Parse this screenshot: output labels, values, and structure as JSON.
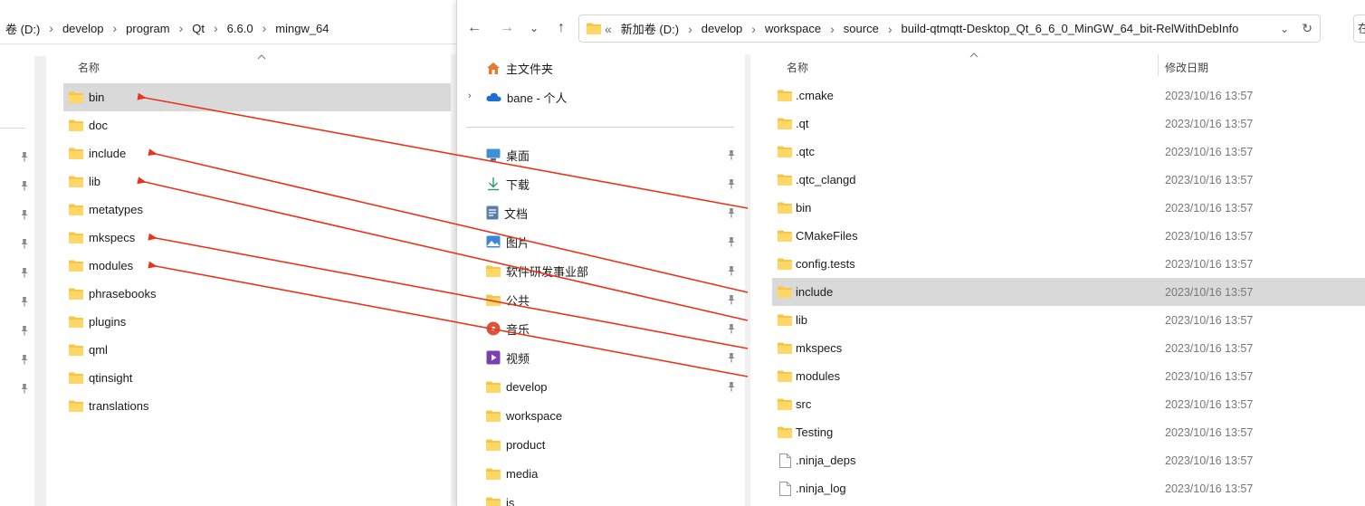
{
  "left": {
    "breadcrumb": [
      "卷 (D:)",
      "develop",
      "program",
      "Qt",
      "6.6.0",
      "mingw_64"
    ],
    "column_name": "名称",
    "items": [
      {
        "name": "bin",
        "selected": true
      },
      {
        "name": "doc"
      },
      {
        "name": "include"
      },
      {
        "name": "lib"
      },
      {
        "name": "metatypes"
      },
      {
        "name": "mkspecs"
      },
      {
        "name": "modules"
      },
      {
        "name": "phrasebooks"
      },
      {
        "name": "plugins"
      },
      {
        "name": "qml"
      },
      {
        "name": "qtinsight"
      },
      {
        "name": "translations"
      }
    ]
  },
  "right": {
    "breadcrumb_prefix": "«",
    "breadcrumb": [
      "新加卷 (D:)",
      "develop",
      "workspace",
      "source",
      "build-qtmqtt-Desktop_Qt_6_6_0_MinGW_64_bit-RelWithDebInfo"
    ],
    "search_placeholder": "在",
    "nav": {
      "home": "主文件夹",
      "onedrive": "bane - 个人",
      "quick": [
        {
          "label": "桌面",
          "icon": "desktop-icon",
          "pinned": true
        },
        {
          "label": "下载",
          "icon": "download-icon",
          "pinned": true
        },
        {
          "label": "文档",
          "icon": "document-icon",
          "pinned": true
        },
        {
          "label": "图片",
          "icon": "picture-icon",
          "pinned": true
        },
        {
          "label": "软件研发事业部",
          "icon": "folder-icon",
          "pinned": true
        },
        {
          "label": "公共",
          "icon": "folder-icon",
          "pinned": true
        },
        {
          "label": "音乐",
          "icon": "music-icon",
          "pinned": true
        },
        {
          "label": "视频",
          "icon": "video-icon",
          "pinned": true
        },
        {
          "label": "develop",
          "icon": "folder-icon",
          "pinned": true
        },
        {
          "label": "workspace",
          "icon": "folder-icon",
          "pinned": false
        },
        {
          "label": "product",
          "icon": "folder-icon",
          "pinned": false
        },
        {
          "label": "media",
          "icon": "folder-icon",
          "pinned": false
        },
        {
          "label": "js",
          "icon": "folder-icon",
          "pinned": false
        }
      ]
    },
    "columns": {
      "name": "名称",
      "date": "修改日期"
    },
    "items": [
      {
        "name": ".cmake",
        "date": "2023/10/16 13:57",
        "type": "folder"
      },
      {
        "name": ".qt",
        "date": "2023/10/16 13:57",
        "type": "folder"
      },
      {
        "name": ".qtc",
        "date": "2023/10/16 13:57",
        "type": "folder"
      },
      {
        "name": ".qtc_clangd",
        "date": "2023/10/16 13:57",
        "type": "folder"
      },
      {
        "name": "bin",
        "date": "2023/10/16 13:57",
        "type": "folder"
      },
      {
        "name": "CMakeFiles",
        "date": "2023/10/16 13:57",
        "type": "folder"
      },
      {
        "name": "config.tests",
        "date": "2023/10/16 13:57",
        "type": "folder"
      },
      {
        "name": "include",
        "date": "2023/10/16 13:57",
        "type": "folder",
        "selected": true
      },
      {
        "name": "lib",
        "date": "2023/10/16 13:57",
        "type": "folder"
      },
      {
        "name": "mkspecs",
        "date": "2023/10/16 13:57",
        "type": "folder"
      },
      {
        "name": "modules",
        "date": "2023/10/16 13:57",
        "type": "folder"
      },
      {
        "name": "src",
        "date": "2023/10/16 13:57",
        "type": "folder"
      },
      {
        "name": "Testing",
        "date": "2023/10/16 13:57",
        "type": "folder"
      },
      {
        "name": ".ninja_deps",
        "date": "2023/10/16 13:57",
        "type": "file"
      },
      {
        "name": ".ninja_log",
        "date": "2023/10/16 13:57",
        "type": "file"
      }
    ]
  },
  "colors": {
    "annotation_arrow": "#e8341c",
    "folder_yellow": "#f8c545",
    "selection": "#d9d9d9"
  }
}
